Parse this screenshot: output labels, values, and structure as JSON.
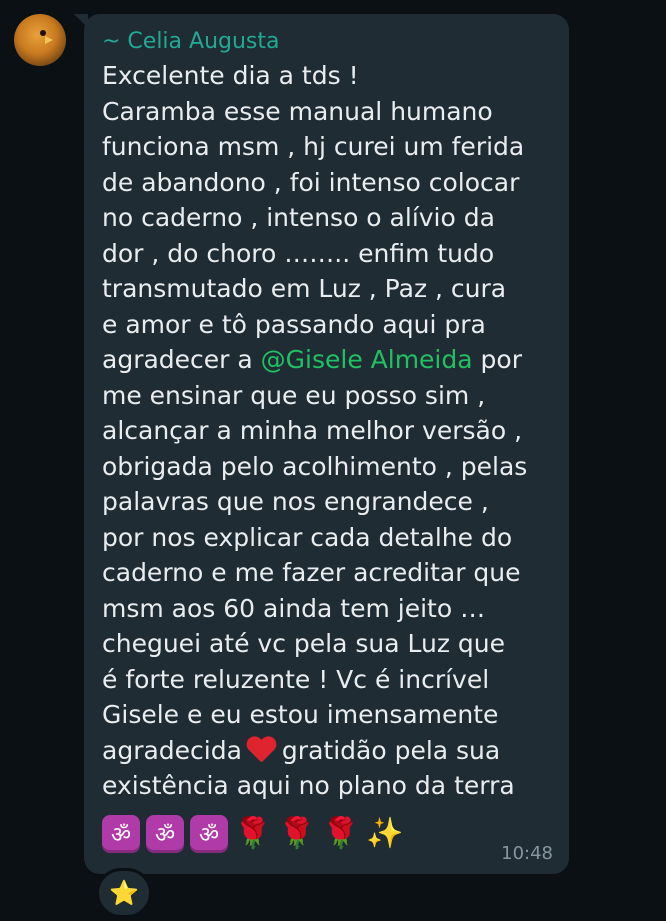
{
  "sender": {
    "name": "~ Celia Augusta"
  },
  "message": {
    "lines": [
      "Excelente dia a tds !",
      "Caramba esse manual humano",
      "funciona msm , hj curei um ferida",
      "de abandono , foi intenso colocar",
      "no caderno , intenso o alívio da",
      "dor , do choro …….. enfim tudo",
      "transmutado em Luz , Paz , cura",
      "e amor e tô passando aqui pra"
    ],
    "line9_pre": "agradecer a ",
    "mention": "@Gisele Almeida",
    "line9_post": " por",
    "lines_after": [
      "me ensinar que eu posso sim ,",
      "alcançar a minha melhor versão ,",
      "obrigada pelo acolhimento , pelas",
      "palavras que nos engrandece ,",
      "por nos explicar cada detalhe do",
      "caderno e me fazer acreditar que",
      "msm aos 60 ainda tem jeito …",
      "cheguei até vc pela sua Luz que",
      "é forte reluzente ! Vc é incrível",
      "Gisele e eu estou imensamente"
    ],
    "line_heart_pre": "agradecida",
    "line_heart_post": "gratidão pela sua",
    "last_line": "existência aqui no plano da terra"
  },
  "emojis": {
    "om": "ॐ",
    "rose": "🌹",
    "sparkles": "✨",
    "heart_icon": "heart-icon"
  },
  "timestamp": "10:48",
  "reaction": {
    "emoji": "⭐"
  },
  "colors": {
    "background": "#0b1014",
    "bubble": "#1f2c34",
    "sender": "#23a894",
    "mention": "#21c063",
    "text": "#e9edef",
    "time": "#8696a0"
  }
}
